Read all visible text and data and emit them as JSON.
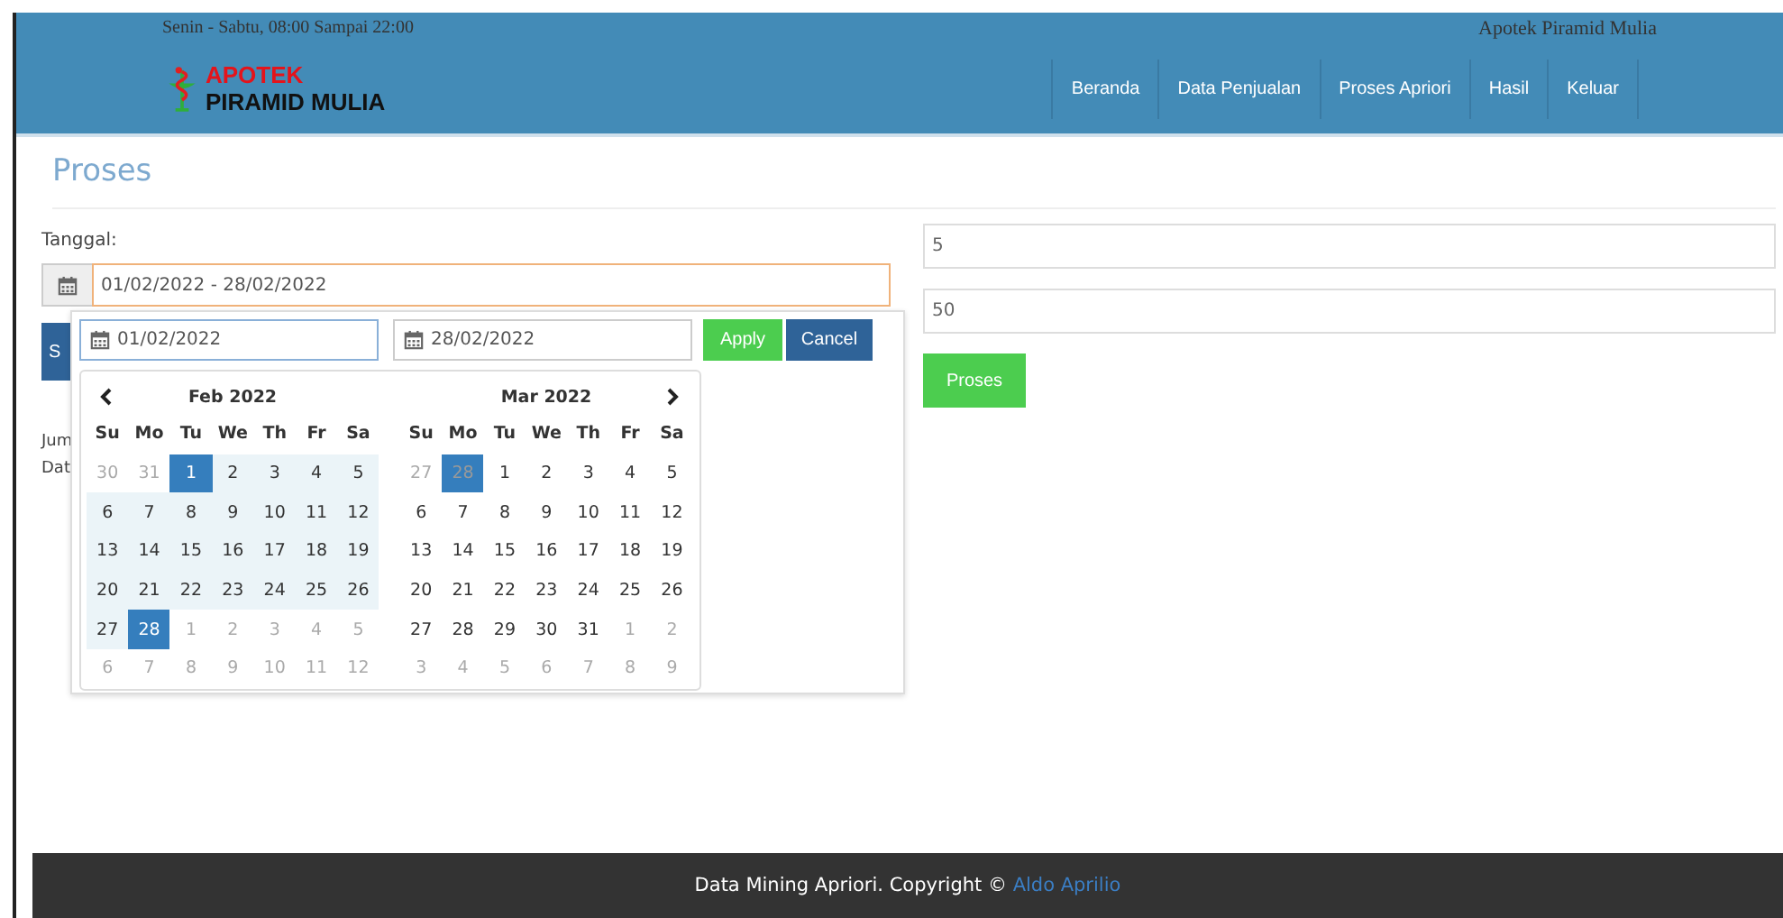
{
  "topbar": {
    "hours": "Senin - Sabtu, 08:00 Sampai 22:00",
    "store_name": "Apotek Piramid Mulia"
  },
  "logo": {
    "line1": "APOTEK",
    "line2": "PIRAMID MULIA"
  },
  "nav": [
    {
      "label": "Beranda",
      "selected": false
    },
    {
      "label": "Data Penjualan",
      "selected": false
    },
    {
      "label": "Proses Apriori",
      "selected": false
    },
    {
      "label": "Hasil",
      "selected": false
    },
    {
      "label": "Keluar",
      "selected": false
    }
  ],
  "page_title": "Proses",
  "form": {
    "date_label": "Tanggal:",
    "date_value": "01/02/2022 - 28/02/2022",
    "hidden_button": "S",
    "hidden_lines": [
      "Jum",
      "Dat"
    ],
    "fields": [
      "5",
      "50"
    ],
    "submit": "Proses"
  },
  "datepicker": {
    "start": "01/02/2022",
    "end": "28/02/2022",
    "apply": "Apply",
    "cancel": "Cancel",
    "months": [
      {
        "title": "Feb 2022",
        "weekdays": [
          "Su",
          "Mo",
          "Tu",
          "We",
          "Th",
          "Fr",
          "Sa"
        ],
        "weeks": [
          [
            {
              "d": "30",
              "kind": "off"
            },
            {
              "d": "31",
              "kind": "off"
            },
            {
              "d": "1",
              "kind": "active"
            },
            {
              "d": "2",
              "kind": "range"
            },
            {
              "d": "3",
              "kind": "range"
            },
            {
              "d": "4",
              "kind": "range"
            },
            {
              "d": "5",
              "kind": "range"
            }
          ],
          [
            {
              "d": "6",
              "kind": "range"
            },
            {
              "d": "7",
              "kind": "range"
            },
            {
              "d": "8",
              "kind": "range"
            },
            {
              "d": "9",
              "kind": "range"
            },
            {
              "d": "10",
              "kind": "range"
            },
            {
              "d": "11",
              "kind": "range"
            },
            {
              "d": "12",
              "kind": "range"
            }
          ],
          [
            {
              "d": "13",
              "kind": "range"
            },
            {
              "d": "14",
              "kind": "range"
            },
            {
              "d": "15",
              "kind": "range"
            },
            {
              "d": "16",
              "kind": "range"
            },
            {
              "d": "17",
              "kind": "range"
            },
            {
              "d": "18",
              "kind": "range"
            },
            {
              "d": "19",
              "kind": "range"
            }
          ],
          [
            {
              "d": "20",
              "kind": "range"
            },
            {
              "d": "21",
              "kind": "range"
            },
            {
              "d": "22",
              "kind": "range"
            },
            {
              "d": "23",
              "kind": "range"
            },
            {
              "d": "24",
              "kind": "range"
            },
            {
              "d": "25",
              "kind": "range"
            },
            {
              "d": "26",
              "kind": "range"
            }
          ],
          [
            {
              "d": "27",
              "kind": "range"
            },
            {
              "d": "28",
              "kind": "active"
            },
            {
              "d": "1",
              "kind": "off"
            },
            {
              "d": "2",
              "kind": "off"
            },
            {
              "d": "3",
              "kind": "off"
            },
            {
              "d": "4",
              "kind": "off"
            },
            {
              "d": "5",
              "kind": "off"
            }
          ],
          [
            {
              "d": "6",
              "kind": "off"
            },
            {
              "d": "7",
              "kind": "off"
            },
            {
              "d": "8",
              "kind": "off"
            },
            {
              "d": "9",
              "kind": "off"
            },
            {
              "d": "10",
              "kind": "off"
            },
            {
              "d": "11",
              "kind": "off"
            },
            {
              "d": "12",
              "kind": "off"
            }
          ]
        ]
      },
      {
        "title": "Mar 2022",
        "weekdays": [
          "Su",
          "Mo",
          "Tu",
          "We",
          "Th",
          "Fr",
          "Sa"
        ],
        "weeks": [
          [
            {
              "d": "27",
              "kind": "off"
            },
            {
              "d": "28",
              "kind": "active-off"
            },
            {
              "d": "1",
              "kind": "day"
            },
            {
              "d": "2",
              "kind": "day"
            },
            {
              "d": "3",
              "kind": "day"
            },
            {
              "d": "4",
              "kind": "day"
            },
            {
              "d": "5",
              "kind": "day"
            }
          ],
          [
            {
              "d": "6",
              "kind": "day"
            },
            {
              "d": "7",
              "kind": "day"
            },
            {
              "d": "8",
              "kind": "day"
            },
            {
              "d": "9",
              "kind": "day"
            },
            {
              "d": "10",
              "kind": "day"
            },
            {
              "d": "11",
              "kind": "day"
            },
            {
              "d": "12",
              "kind": "day"
            }
          ],
          [
            {
              "d": "13",
              "kind": "day"
            },
            {
              "d": "14",
              "kind": "day"
            },
            {
              "d": "15",
              "kind": "day"
            },
            {
              "d": "16",
              "kind": "day"
            },
            {
              "d": "17",
              "kind": "day"
            },
            {
              "d": "18",
              "kind": "day"
            },
            {
              "d": "19",
              "kind": "day"
            }
          ],
          [
            {
              "d": "20",
              "kind": "day"
            },
            {
              "d": "21",
              "kind": "day"
            },
            {
              "d": "22",
              "kind": "day"
            },
            {
              "d": "23",
              "kind": "day"
            },
            {
              "d": "24",
              "kind": "day"
            },
            {
              "d": "25",
              "kind": "day"
            },
            {
              "d": "26",
              "kind": "day"
            }
          ],
          [
            {
              "d": "27",
              "kind": "day"
            },
            {
              "d": "28",
              "kind": "day"
            },
            {
              "d": "29",
              "kind": "day"
            },
            {
              "d": "30",
              "kind": "day"
            },
            {
              "d": "31",
              "kind": "day"
            },
            {
              "d": "1",
              "kind": "off"
            },
            {
              "d": "2",
              "kind": "off"
            }
          ],
          [
            {
              "d": "3",
              "kind": "off"
            },
            {
              "d": "4",
              "kind": "off"
            },
            {
              "d": "5",
              "kind": "off"
            },
            {
              "d": "6",
              "kind": "off"
            },
            {
              "d": "7",
              "kind": "off"
            },
            {
              "d": "8",
              "kind": "off"
            },
            {
              "d": "9",
              "kind": "off"
            }
          ]
        ]
      }
    ]
  },
  "footer": {
    "text": "Data Mining Apriori. Copyright ©",
    "author": "Aldo Aprilio"
  }
}
